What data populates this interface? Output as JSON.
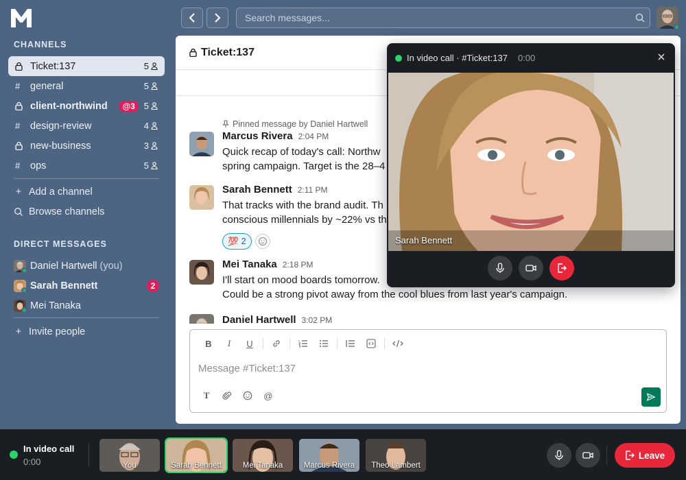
{
  "app": {
    "logo_letter": "M"
  },
  "search": {
    "placeholder": "Search messages..."
  },
  "sidebar": {
    "channels_heading": "CHANNELS",
    "channels": [
      {
        "prefix": "lock",
        "name": "Ticket:137",
        "count": "5",
        "active": true,
        "bold": false,
        "mention": ""
      },
      {
        "prefix": "#",
        "name": "general",
        "count": "5",
        "active": false,
        "bold": false,
        "mention": ""
      },
      {
        "prefix": "lock",
        "name": "client-northwind",
        "count": "5",
        "active": false,
        "bold": true,
        "mention": "@3"
      },
      {
        "prefix": "#",
        "name": "design-review",
        "count": "4",
        "active": false,
        "bold": false,
        "mention": ""
      },
      {
        "prefix": "lock",
        "name": "new-business",
        "count": "3",
        "active": false,
        "bold": false,
        "mention": ""
      },
      {
        "prefix": "#",
        "name": "ops",
        "count": "5",
        "active": false,
        "bold": false,
        "mention": ""
      }
    ],
    "add_channel": "Add a channel",
    "browse_channels": "Browse channels",
    "dm_heading": "DIRECT MESSAGES",
    "dms": [
      {
        "name": "Daniel Hartwell",
        "suffix": "(you)",
        "bold": false,
        "badge": ""
      },
      {
        "name": "Sarah Bennett",
        "suffix": "",
        "bold": true,
        "badge": "2"
      },
      {
        "name": "Mei Tanaka",
        "suffix": "",
        "bold": false,
        "badge": ""
      }
    ],
    "invite": "Invite people"
  },
  "main": {
    "channel_title": "Ticket:137",
    "pinned": "Pinned message by Daniel Hartwell",
    "messages": [
      {
        "author": "Marcus Rivera",
        "time": "2:04 PM",
        "lines": [
          "Quick recap of today's call: Northw",
          "spring campaign. Target is the 28–4"
        ]
      },
      {
        "author": "Sarah Bennett",
        "time": "2:11 PM",
        "lines": [
          "That tracks with the brand audit. Th",
          "conscious millennials by ~22% vs th"
        ],
        "reaction": {
          "emoji": "💯",
          "count": "2"
        }
      },
      {
        "author": "Mei Tanaka",
        "time": "2:18 PM",
        "lines": [
          "I'll start on mood boards tomorrow.",
          "Could be a strong pivot away from the cool blues from last year's campaign."
        ]
      },
      {
        "author": "Daniel Hartwell",
        "time": "3:02 PM",
        "lines": []
      }
    ],
    "composer_placeholder": "Message #Ticket:137"
  },
  "video_panel": {
    "title": "In video call · #Ticket:137",
    "timer": "0:00",
    "speaker": "Sarah Bennett"
  },
  "call_bar": {
    "status": "In video call",
    "timer": "0:00",
    "participants": [
      "You",
      "Sarah Bennett",
      "Mei Tanaka",
      "Marcus Rivera",
      "Theo Lambert"
    ],
    "selected": "Sarah Bennett",
    "leave_label": "Leave"
  },
  "colors": {
    "sidebar_bg": "#4d6482",
    "mention_badge": "#e01e5a",
    "online_green": "#2bd46a",
    "leave_red": "#e8283a",
    "send_green": "#007a5a"
  }
}
